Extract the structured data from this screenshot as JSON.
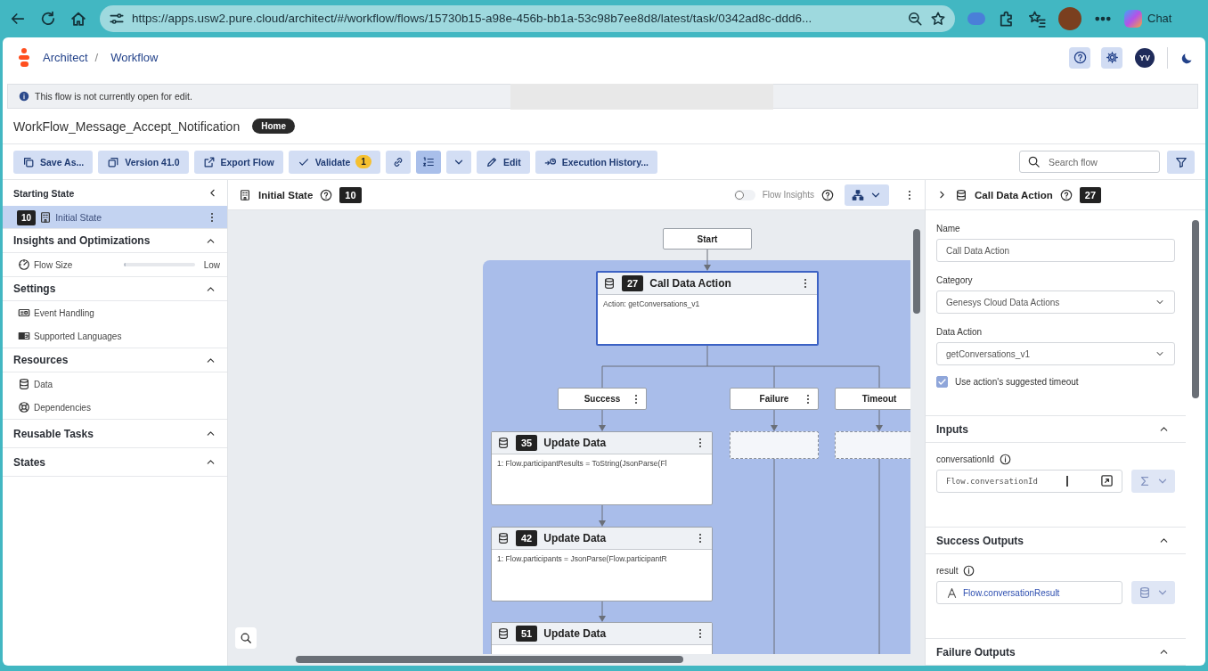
{
  "browser": {
    "url": "https://apps.usw2.pure.cloud/architect/#/workflow/flows/15730b15-a98e-456b-bb1a-53c98b7ee8d8/latest/task/0342ad8c-ddd6...",
    "chat_label": "Chat"
  },
  "app": {
    "breadcrumbs": [
      "Architect",
      "Workflow"
    ],
    "breadcrumb_separator": "/",
    "user_initials": "YV"
  },
  "banner": {
    "message": "This flow is not currently open for edit."
  },
  "flow": {
    "name": "WorkFlow_Message_Accept_Notification",
    "badge": "Home"
  },
  "toolbar": {
    "items": [
      {
        "kind": "button",
        "label": "Save As...",
        "selected": false
      },
      {
        "kind": "button",
        "label": "Version 41.0",
        "selected": false
      },
      {
        "kind": "button",
        "label": "Export Flow",
        "selected": false
      },
      {
        "kind": "button",
        "label": "Validate",
        "count": "1",
        "selected": false
      },
      {
        "kind": "icon-button",
        "selected": false
      },
      {
        "kind": "split-button",
        "selected": true
      },
      {
        "kind": "button",
        "label": "Edit",
        "selected": false
      },
      {
        "kind": "button",
        "label": "Execution History...",
        "selected": false
      }
    ],
    "search": {
      "placeholder": "Search flow"
    }
  },
  "sidebar": {
    "title": "Starting State",
    "state_item": {
      "number": "10",
      "label": "Initial State",
      "selected": true
    },
    "sections": [
      {
        "title": "Insights and Optimizations",
        "expanded": true,
        "items": [
          {
            "kind": "meter",
            "label": "Flow Size",
            "level": 0.03,
            "reading": "Low"
          }
        ]
      },
      {
        "title": "Settings",
        "expanded": true,
        "items": [
          {
            "kind": "link",
            "label": "Event Handling"
          },
          {
            "kind": "link",
            "label": "Supported Languages"
          }
        ]
      },
      {
        "title": "Resources",
        "expanded": true,
        "items": [
          {
            "kind": "link",
            "label": "Data"
          },
          {
            "kind": "link",
            "label": "Dependencies"
          }
        ]
      },
      {
        "title": "Reusable Tasks",
        "expanded": true
      },
      {
        "title": "States",
        "expanded": true
      }
    ]
  },
  "canvas": {
    "title": "Initial State",
    "number": "10",
    "flow_insights": {
      "label": "Flow Insights",
      "on": false
    },
    "nodes": [
      {
        "kind": "terminal",
        "label": "Start"
      },
      {
        "kind": "action",
        "number": "27",
        "title": "Call Data Action",
        "body": "Action: getConversations_v1",
        "selected": true
      },
      {
        "kind": "path",
        "label": "Success"
      },
      {
        "kind": "path",
        "label": "Failure"
      },
      {
        "kind": "path",
        "label": "Timeout"
      },
      {
        "kind": "placeholder"
      },
      {
        "kind": "placeholder"
      },
      {
        "kind": "action",
        "number": "35",
        "title": "Update Data",
        "body": "1: Flow.participantResults = ToString(JsonParse(Fl",
        "selected": false
      },
      {
        "kind": "action",
        "number": "42",
        "title": "Update Data",
        "body": "1: Flow.participants = JsonParse(Flow.participantR",
        "selected": false
      },
      {
        "kind": "action",
        "number": "51",
        "title": "Update Data",
        "selected": false
      }
    ]
  },
  "properties": {
    "title": "Call Data Action",
    "number": "27",
    "fields": [
      {
        "kind": "text",
        "label": "Name",
        "value": "Call Data Action"
      },
      {
        "kind": "select",
        "label": "Category",
        "value": "Genesys Cloud Data Actions"
      },
      {
        "kind": "select",
        "label": "Data Action",
        "value": "getConversations_v1"
      },
      {
        "kind": "checkbox",
        "label": "Use action's suggested timeout",
        "checked": true
      }
    ],
    "sections": [
      {
        "title": "Inputs",
        "expanded": true,
        "fields": [
          {
            "kind": "expression",
            "label": "conversationId",
            "value": "Flow.conversationId"
          }
        ]
      },
      {
        "title": "Success Outputs",
        "expanded": true,
        "fields": [
          {
            "kind": "variable",
            "label": "result",
            "value": "Flow.conversationResult"
          }
        ]
      },
      {
        "title": "Failure Outputs",
        "expanded": true
      }
    ]
  }
}
